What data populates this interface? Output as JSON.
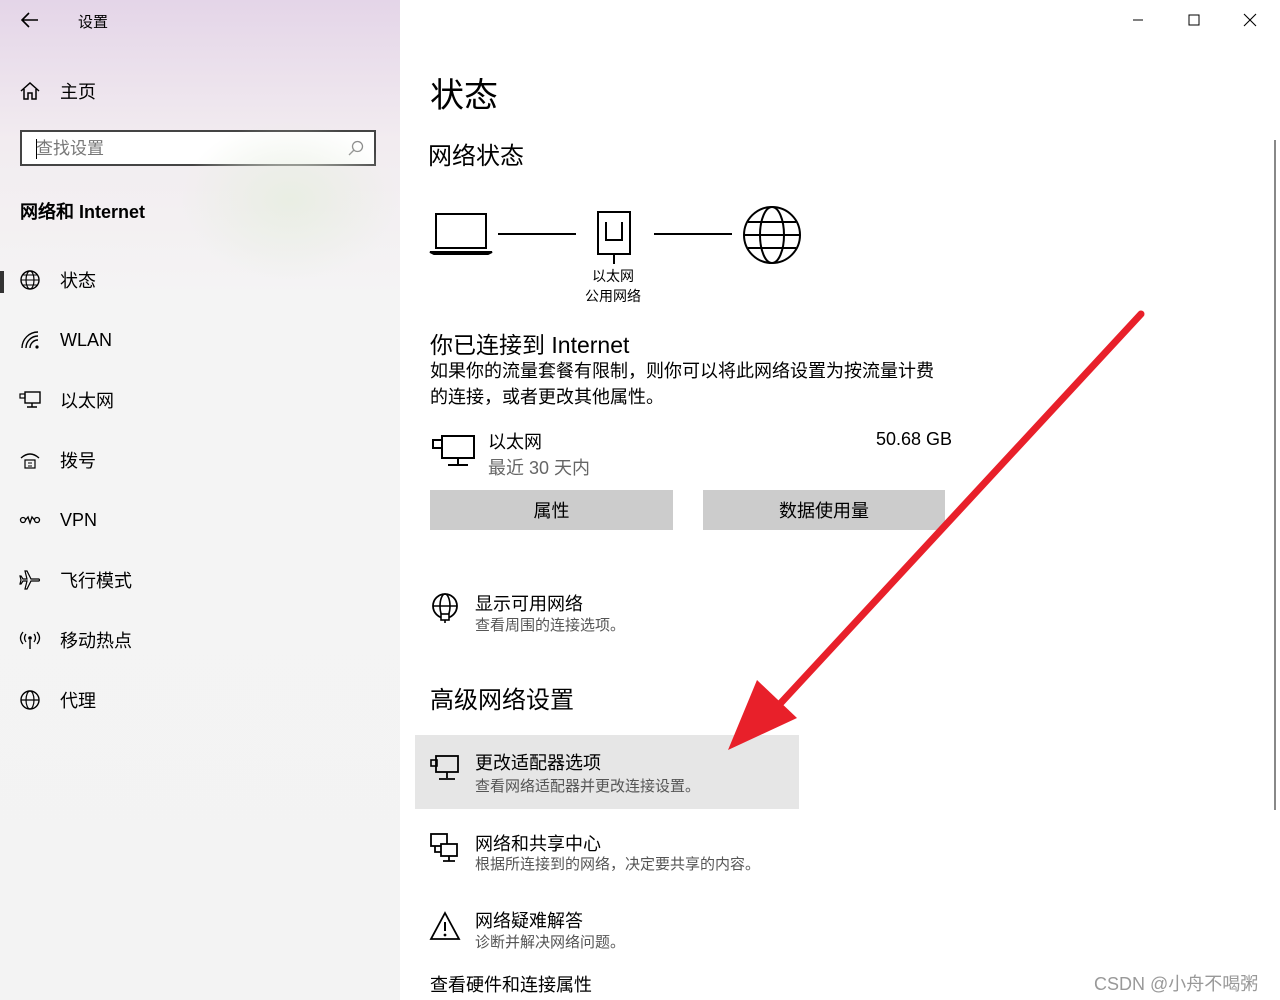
{
  "window": {
    "title": "设置",
    "controls": [
      "minimize-icon",
      "maximize-icon",
      "close-icon"
    ]
  },
  "sidebar": {
    "home_label": "主页",
    "search_placeholder": "查找设置",
    "section_title": "网络和 Internet",
    "items": [
      {
        "label": "状态",
        "icon": "globe-status-icon",
        "active": true
      },
      {
        "label": "WLAN",
        "icon": "wifi-icon",
        "active": false
      },
      {
        "label": "以太网",
        "icon": "ethernet-icon",
        "active": false
      },
      {
        "label": "拨号",
        "icon": "dialup-icon",
        "active": false
      },
      {
        "label": "VPN",
        "icon": "vpn-icon",
        "active": false
      },
      {
        "label": "飞行模式",
        "icon": "airplane-icon",
        "active": false
      },
      {
        "label": "移动热点",
        "icon": "hotspot-icon",
        "active": false
      },
      {
        "label": "代理",
        "icon": "globe-icon",
        "active": false
      }
    ]
  },
  "main": {
    "page_title": "状态",
    "network_status_heading": "网络状态",
    "diagram": {
      "network_name": "以太网",
      "network_type": "公用网络"
    },
    "connected_title": "你已连接到 Internet",
    "connected_desc": "如果你的流量套餐有限制，则你可以将此网络设置为按流量计费的连接，或者更改其他属性。",
    "adapter": {
      "name": "以太网",
      "period": "最近 30 天内",
      "usage": "50.68 GB"
    },
    "buttons": {
      "properties": "属性",
      "data_usage": "数据使用量"
    },
    "show_networks": {
      "title": "显示可用网络",
      "desc": "查看周围的连接选项。"
    },
    "advanced_heading": "高级网络设置",
    "advanced_links": [
      {
        "title": "更改适配器选项",
        "desc": "查看网络适配器并更改连接设置。"
      },
      {
        "title": "网络和共享中心",
        "desc": "根据所连接到的网络，决定要共享的内容。"
      },
      {
        "title": "网络疑难解答",
        "desc": "诊断并解决网络问题。"
      }
    ],
    "hardware_link": "查看硬件和连接属性"
  },
  "watermark": "CSDN @小舟不喝粥",
  "colors": {
    "annotation_arrow": "#e8202a",
    "button_bg": "#cccccc",
    "hover_bg": "#e6e6e6"
  }
}
